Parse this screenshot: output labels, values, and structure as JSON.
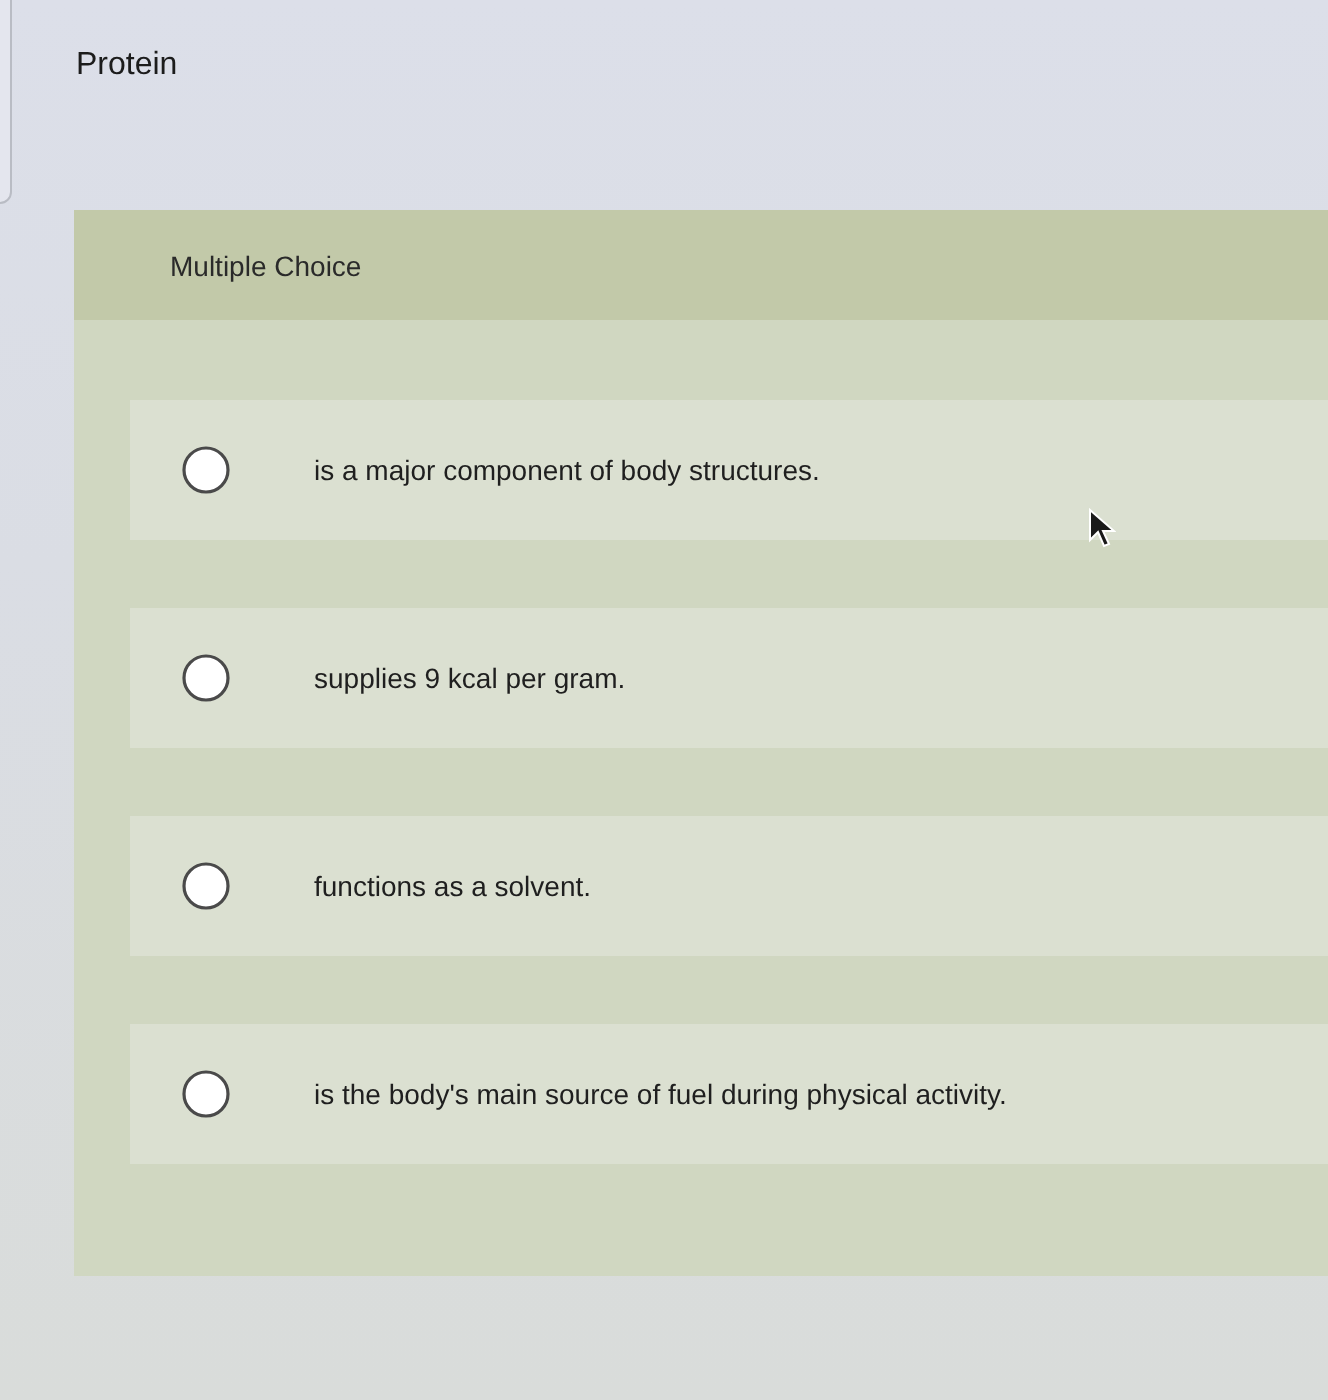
{
  "title": "Protein",
  "question": {
    "type_label": "Multiple Choice",
    "options": [
      {
        "text": "is a major component of body structures.",
        "selected": false
      },
      {
        "text": "supplies 9 kcal per gram.",
        "selected": false
      },
      {
        "text": "functions as a solvent.",
        "selected": false
      },
      {
        "text": "is the body's main source of fuel during physical activity.",
        "selected": false
      }
    ]
  }
}
